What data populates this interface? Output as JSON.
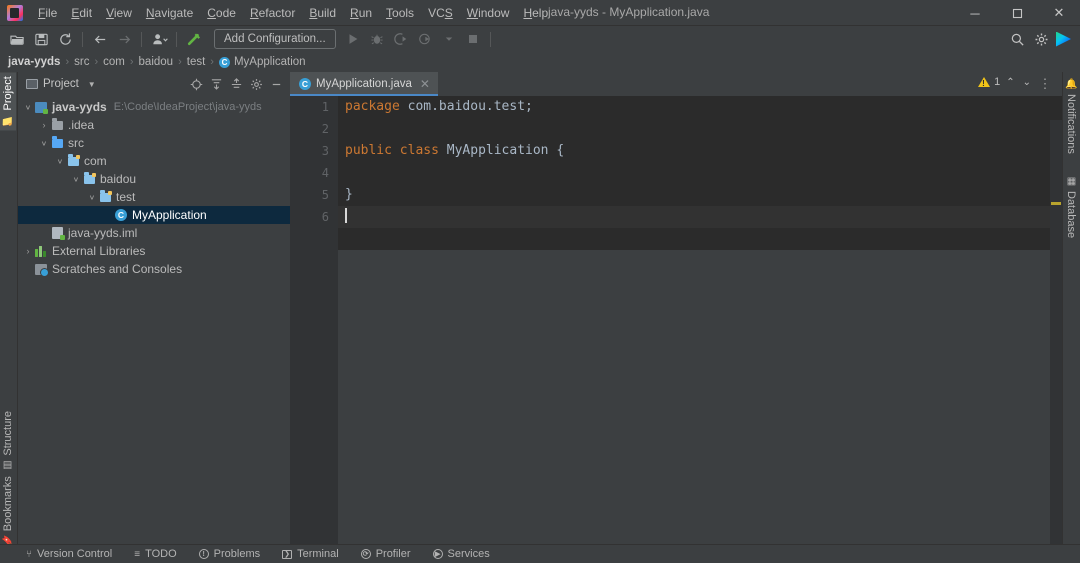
{
  "window": {
    "title": "java-yyds - MyApplication.java",
    "logo_icon": "intellij-idea-logo",
    "minimize_label": "─",
    "maximize_label": "❐",
    "close_label": "✕"
  },
  "menubar": {
    "items": [
      {
        "label": "File",
        "mnemonic": "F",
        "rest": "ile"
      },
      {
        "label": "Edit",
        "mnemonic": "E",
        "rest": "dit"
      },
      {
        "label": "View",
        "mnemonic": "V",
        "rest": "iew"
      },
      {
        "label": "Navigate",
        "mnemonic": "N",
        "rest": "avigate"
      },
      {
        "label": "Code",
        "mnemonic": "C",
        "rest": "ode"
      },
      {
        "label": "Refactor",
        "mnemonic": "R",
        "rest": "efactor"
      },
      {
        "label": "Build",
        "mnemonic": "B",
        "rest": "uild"
      },
      {
        "label": "Run",
        "mnemonic": "R",
        "rest": "un"
      },
      {
        "label": "Tools",
        "mnemonic": "T",
        "rest": "ools"
      },
      {
        "label": "VCS",
        "mnemonic": "S",
        "rest": "VC"
      },
      {
        "label": "Window",
        "mnemonic": "W",
        "rest": "indow"
      },
      {
        "label": "Help",
        "mnemonic": "H",
        "rest": "elp"
      }
    ]
  },
  "toolbar": {
    "open_icon": "open-folder-icon",
    "save_icon": "save-disk-icon",
    "sync_icon": "sync-refresh-icon",
    "back_icon": "back-arrow-icon",
    "forward_icon": "forward-arrow-icon",
    "profiles_icon": "user-profile-icon",
    "build_icon": "build-hammer-icon",
    "run_config_label": "Add Configuration...",
    "run_icon": "run-play-icon",
    "debug_icon": "debug-bug-icon",
    "coverage_icon": "run-with-coverage-icon",
    "profile_icon": "profiler-icon",
    "more_run_icon": "chevron-down-icon",
    "stop_icon": "stop-square-icon",
    "search_icon": "search-icon",
    "settings_icon": "gear-icon",
    "ide_icon": "intellij-play-icon"
  },
  "breadcrumb": {
    "separator": "›",
    "items": [
      {
        "label": "java-yyds",
        "bold": true,
        "icon": ""
      },
      {
        "label": "src",
        "bold": false,
        "icon": ""
      },
      {
        "label": "com",
        "bold": false,
        "icon": ""
      },
      {
        "label": "baidou",
        "bold": false,
        "icon": ""
      },
      {
        "label": "test",
        "bold": false,
        "icon": ""
      },
      {
        "label": "MyApplication",
        "bold": false,
        "icon": "class-icon"
      }
    ],
    "class_badge": "C"
  },
  "left_stripe": {
    "top_tab": {
      "label": "Project",
      "icon": "project-folder-icon",
      "selected": true
    },
    "bottom_tabs": [
      {
        "label": "Structure",
        "icon": "structure-icon"
      },
      {
        "label": "Bookmarks",
        "icon": "bookmark-icon"
      }
    ]
  },
  "right_stripe": {
    "tabs": [
      {
        "label": "Notifications",
        "icon": "notifications-bell-icon"
      },
      {
        "label": "Database",
        "icon": "database-icon"
      }
    ]
  },
  "project_panel": {
    "title": "Project",
    "dropdown_icon": "chevron-down-icon",
    "tools": [
      {
        "name": "locate-target-icon",
        "glyph": "⊙"
      },
      {
        "name": "expand-all-icon",
        "glyph": "⤓"
      },
      {
        "name": "collapse-all-icon",
        "glyph": "⤒"
      },
      {
        "name": "settings-gear-icon",
        "glyph": "⚙"
      },
      {
        "name": "hide-panel-icon",
        "glyph": "−"
      }
    ],
    "tree": [
      {
        "label": "java-yyds",
        "path": "E:\\Code\\IdeaProject\\java-yyds",
        "indent": 0,
        "arrow": "∨",
        "icon": "module-project-icon",
        "bold": true,
        "selected": false
      },
      {
        "label": ".idea",
        "path": "",
        "indent": 1,
        "arrow": "›",
        "icon": "folder-grey-icon",
        "bold": false,
        "selected": false
      },
      {
        "label": "src",
        "path": "",
        "indent": 1,
        "arrow": "∨",
        "icon": "source-folder-icon",
        "bold": false,
        "selected": false
      },
      {
        "label": "com",
        "path": "",
        "indent": 2,
        "arrow": "∨",
        "icon": "package-folder-icon",
        "bold": false,
        "selected": false
      },
      {
        "label": "baidou",
        "path": "",
        "indent": 3,
        "arrow": "∨",
        "icon": "package-folder-icon",
        "bold": false,
        "selected": false
      },
      {
        "label": "test",
        "path": "",
        "indent": 4,
        "arrow": "∨",
        "icon": "package-folder-icon",
        "bold": false,
        "selected": false
      },
      {
        "label": "MyApplication",
        "path": "",
        "indent": 5,
        "arrow": "",
        "icon": "class-icon",
        "bold": false,
        "selected": true
      },
      {
        "label": "java-yyds.iml",
        "path": "",
        "indent": 1,
        "arrow": "",
        "icon": "iml-file-icon",
        "bold": false,
        "selected": false
      },
      {
        "label": "External Libraries",
        "path": "",
        "indent": 0,
        "arrow": "›",
        "icon": "libraries-icon",
        "bold": false,
        "selected": false
      },
      {
        "label": "Scratches and Consoles",
        "path": "",
        "indent": 0,
        "arrow": "",
        "icon": "scratches-icon",
        "bold": false,
        "selected": false
      }
    ]
  },
  "editor": {
    "tab": {
      "label": "MyApplication.java",
      "icon": "class-icon",
      "badge": "C",
      "close_icon": "✕"
    },
    "more_tabs_icon": "⋮",
    "inspections": {
      "warning_count": "1",
      "warning_icon": "warning-triangle-icon",
      "prev_icon": "⌃",
      "next_icon": "⌄"
    },
    "lines": [
      {
        "n": "1",
        "tokens": [
          {
            "t": "package",
            "c": "kw"
          },
          {
            "t": " com.baidou.test;",
            "c": "pl"
          }
        ]
      },
      {
        "n": "2",
        "tokens": []
      },
      {
        "n": "3",
        "tokens": [
          {
            "t": "public",
            "c": "kw"
          },
          {
            "t": " ",
            "c": "pl"
          },
          {
            "t": "class",
            "c": "kw"
          },
          {
            "t": " MyApplication {",
            "c": "pl"
          }
        ]
      },
      {
        "n": "4",
        "tokens": []
      },
      {
        "n": "5",
        "tokens": [
          {
            "t": "}",
            "c": "pl"
          }
        ]
      },
      {
        "n": "6",
        "tokens": [],
        "caret": true
      }
    ]
  },
  "statusbar": {
    "items": [
      {
        "label": "Version Control",
        "icon": "version-control-branch-icon",
        "glyph": "⑂"
      },
      {
        "label": "TODO",
        "icon": "todo-list-icon",
        "glyph": "≡"
      },
      {
        "label": "Problems",
        "icon": "problems-icon",
        "glyph": "!"
      },
      {
        "label": "Terminal",
        "icon": "terminal-icon",
        "glyph": "❯"
      },
      {
        "label": "Profiler",
        "icon": "profiler-icon",
        "glyph": "⟳"
      },
      {
        "label": "Services",
        "icon": "services-icon",
        "glyph": "▶"
      }
    ]
  },
  "colors": {
    "editor_bg": "#2b2b2b",
    "panel_bg": "#3c3f41",
    "gutter_bg": "#313335",
    "selection_bg": "#0d293e",
    "keyword": "#cc7832",
    "plain": "#a9b7c6",
    "accent": "#4a88c7",
    "warning": "#f0c419"
  }
}
